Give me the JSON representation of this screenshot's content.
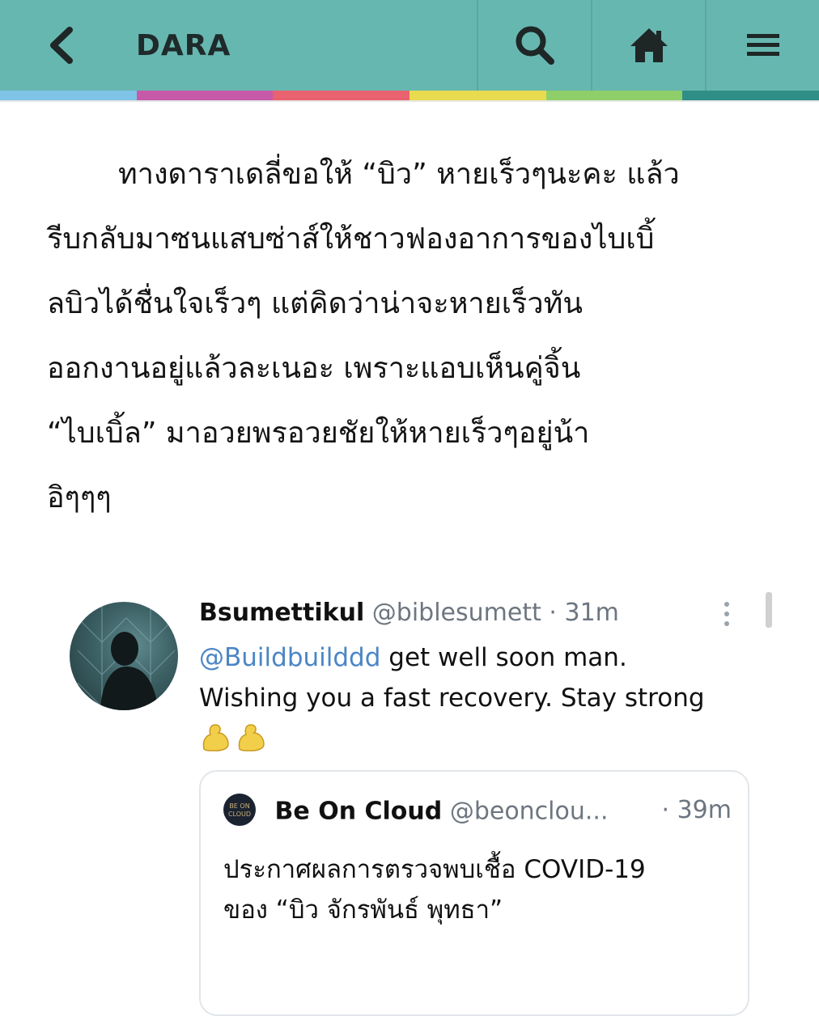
{
  "header": {
    "back_icon": "chevron-left-icon",
    "logo": "DARA",
    "search_icon": "search-icon",
    "home_icon": "home-icon",
    "menu_icon": "hamburger-menu-icon",
    "background": "#67b7b1"
  },
  "colorbar": [
    "#7fc4e6",
    "#c75aa8",
    "#e9626f",
    "#e8db4f",
    "#8fcf6a",
    "#2f8f86"
  ],
  "article": {
    "lines": [
      "ทางดาราเดลี่ขอให้ “บิว” หายเร็วๆนะคะ แล้ว",
      "รีบกลับมาซนแสบซ่าส์ให้ชาวฟองอาการของไบเบิ้",
      "ลบิวได้ชื่นใจเร็วๆ แต่คิดว่าน่าจะหายเร็วทัน",
      "ออกงานอยู่แล้วละเนอะ เพราะแอบเห็นคู่จิ้น",
      "“ไบเบิ้ล” มาอวยพรอวยชัยให้หายเร็วๆอยู่น้า",
      "อิๆๆๆ"
    ]
  },
  "tweet": {
    "name": "Bsumettikul",
    "handle": "@biblesumett",
    "time": "· 31m",
    "mention": "@Buildbuilddd",
    "text_after_mention": " get well soon man.",
    "line2": "Wishing you a fast recovery. Stay strong",
    "emoji": "flexed-biceps-icon",
    "emoji_count": 2,
    "more_icon": "more-vertical-icon",
    "quote": {
      "name": "Be On Cloud",
      "handle": "@beonclou...",
      "time": "· 39m",
      "line1": "ประกาศผลการตรวจพบเชื้อ COVID-19",
      "line2": "ของ “บิว จักรพันธ์ พุทธา”"
    }
  }
}
